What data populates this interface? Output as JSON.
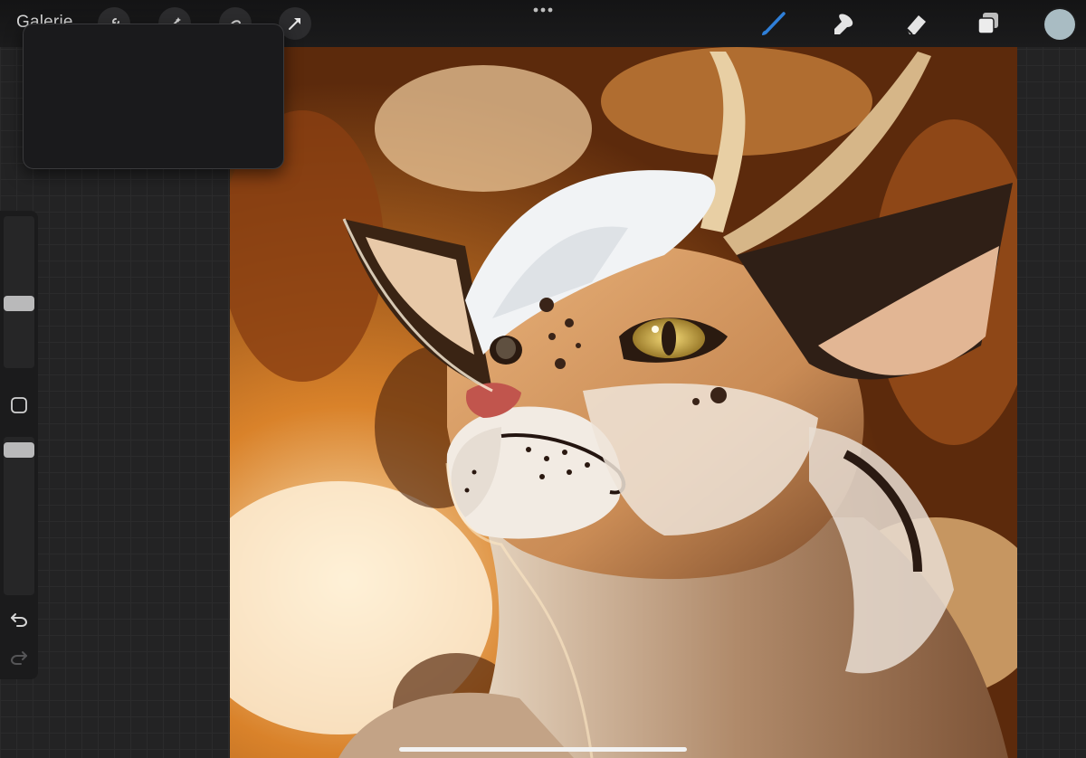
{
  "app": {
    "gallery_label": "Galerie"
  },
  "toolbar": {
    "left_tools": [
      {
        "name": "actions-wrench-icon"
      },
      {
        "name": "adjustments-magic-wand-icon"
      },
      {
        "name": "selection-icon"
      },
      {
        "name": "transform-arrow-icon"
      }
    ],
    "right_tools": [
      {
        "name": "brush-icon",
        "active": true
      },
      {
        "name": "smudge-icon",
        "active": false
      },
      {
        "name": "eraser-icon",
        "active": false
      },
      {
        "name": "layers-icon",
        "active": false
      }
    ],
    "active_color": "#a9bcc3",
    "accent_color": "#2f7fd8"
  },
  "sidebar": {
    "brush_size_slider": {
      "value": 0.42
    },
    "opacity_slider": {
      "value": 0.96
    },
    "undo_icon": "undo-arrow-icon",
    "redo_icon": "redo-arrow-icon"
  },
  "canvas": {
    "content": "painting"
  }
}
